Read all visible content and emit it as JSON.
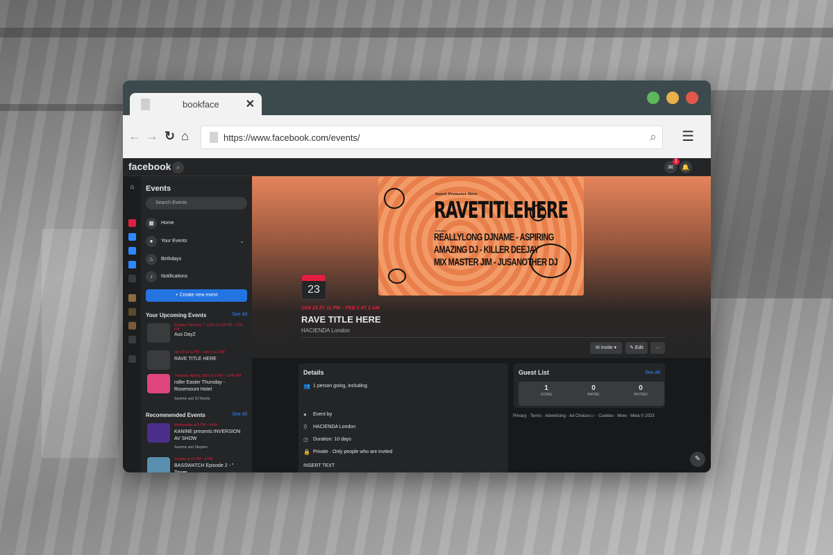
{
  "browser": {
    "tab_title": "bookface",
    "tab_close": "✕",
    "url": "https://www.facebook.com/events/"
  },
  "fb": {
    "logo": "facebook",
    "notif_count": "1"
  },
  "sidebar": {
    "title": "Events",
    "search_placeholder": "Search Events",
    "items": [
      {
        "label": "Home",
        "icon": "calendar-grid-icon"
      },
      {
        "label": "Your Events",
        "icon": "person-icon"
      },
      {
        "label": "Birthdays",
        "icon": "cake-icon"
      },
      {
        "label": "Notifications",
        "icon": "bell-icon"
      }
    ],
    "create_label": "+ Create new event",
    "upcoming_title": "Your Upcoming Events",
    "see_all": "See All",
    "upcoming": [
      {
        "date": "Sunday, February 7, 2106 at 2:28 PM – 2:28 PM",
        "name": "Aus DayZ",
        "friends": ""
      },
      {
        "date": "Jan 23 at 11 PM – Feb 2 at 2 AM",
        "name": "RAVE TITLE HERE",
        "friends": ""
      },
      {
        "date": "Thursday, April 6, 2023 at 9 PM – 11:45 PM",
        "name": "roller Easter Thursday - Rosemount Hotel",
        "friends": "Sammie and 10 friends"
      }
    ],
    "recommended_title": "Recommended Events",
    "recommended": [
      {
        "date": "Wednesday at 9 PM – 4 AM",
        "name": "KANINE presents INVERSION AV SHOW",
        "friends": "Sammie and Stephen"
      },
      {
        "date": "Sunday at 12 PM – 8 PM",
        "name": "BASSWATCH Episode 2 - \" Tower",
        "friends": ""
      }
    ]
  },
  "cover": {
    "promoter": "Insert Promoter Here",
    "title": "RAVETITLEHERE",
    "featuring": "featuring",
    "lines": [
      "REALLYLONG DJNAME - ASPIRING",
      "AMAZING DJ - KILLER DEEJAY",
      "MIX MASTER JIM - JUSANOTHER DJ"
    ]
  },
  "event": {
    "day": "23",
    "date_range": "JAN 23 AT 11 PM – FEB 2 AT 2 AM",
    "title": "RAVE TITLE HERE",
    "location": "HACIENDA London",
    "invite_label": "✉ Invite ▾",
    "edit_label": "✎ Edit",
    "more_label": "···"
  },
  "details": {
    "title": "Details",
    "going": "1 person going, including",
    "event_by": "Event by",
    "venue": "HACIENDA London",
    "duration": "Duration: 10 days",
    "privacy": "Private · Only people who are invited",
    "text": "INSERT TEXT"
  },
  "guests": {
    "title": "Guest List",
    "see_all": "See All",
    "going_n": "1",
    "going_l": "GOING",
    "maybe_n": "0",
    "maybe_l": "MAYBE",
    "invited_n": "0",
    "invited_l": "INVITED"
  },
  "footer": "Privacy · Terms · Advertising · Ad Choices ▷ · Cookies · More · Meta © 2023",
  "colors": {
    "accent": "#2374e1",
    "date_red": "#e41e3f",
    "bg": "#18191a"
  }
}
